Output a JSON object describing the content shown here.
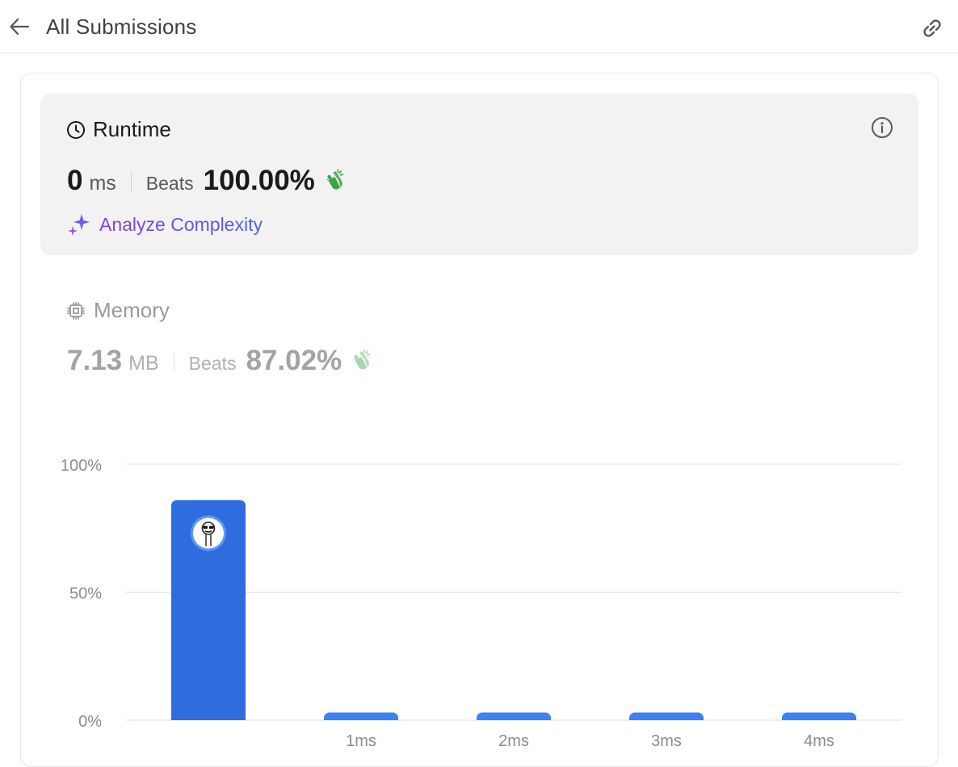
{
  "header": {
    "title": "All Submissions",
    "back_icon": "arrow-left-icon",
    "link_icon": "link-icon"
  },
  "runtime": {
    "label": "Runtime",
    "value": "0",
    "unit": "ms",
    "beats_label": "Beats",
    "beats_value": "100.00%",
    "analyze_label": "Analyze Complexity",
    "icons": [
      "clock-icon",
      "info-icon",
      "clap-icon",
      "sparkle-icon"
    ]
  },
  "memory": {
    "label": "Memory",
    "value": "7.13",
    "unit": "MB",
    "beats_label": "Beats",
    "beats_value": "87.02%",
    "icons": [
      "chip-icon",
      "clap-icon"
    ]
  },
  "colors": {
    "bar_selected": "#2f6ddf",
    "bar": "#3c82f6",
    "clap_active": "#3aa348",
    "clap_muted": "#a7d6ad",
    "gradient_start": "#8a3fe0",
    "gradient_end": "#4f63ea"
  },
  "chart_data": {
    "type": "bar",
    "categories": [
      "",
      "1ms",
      "2ms",
      "3ms",
      "4ms"
    ],
    "values": [
      86,
      3,
      3,
      3,
      3
    ],
    "ylim": [
      0,
      100
    ],
    "yticks": [
      "0%",
      "50%",
      "100%"
    ],
    "ytick_values": [
      0,
      50,
      100
    ],
    "selected_index": 0,
    "selected_marker": "user-avatar",
    "grid": true
  }
}
